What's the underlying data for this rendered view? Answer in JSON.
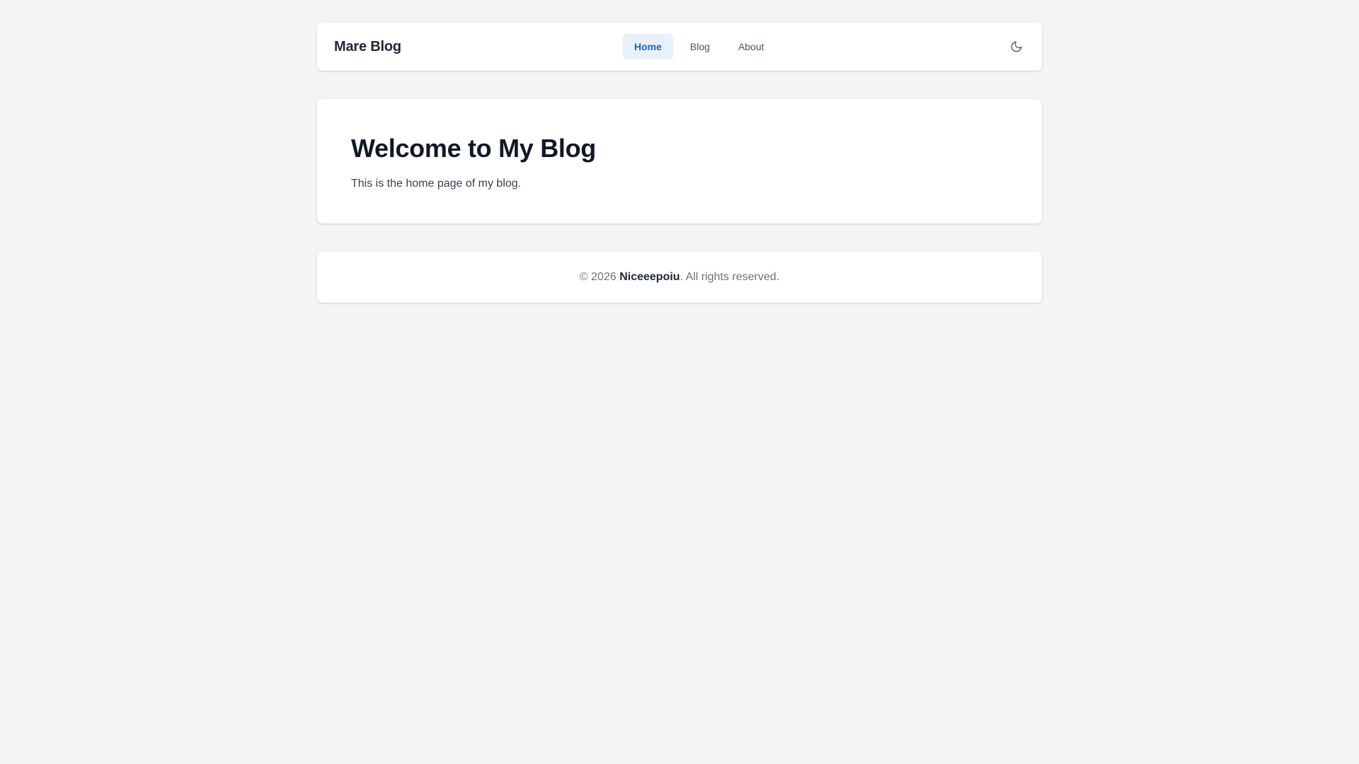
{
  "header": {
    "brand": "Mare Blog",
    "nav": [
      {
        "label": "Home",
        "active": true
      },
      {
        "label": "Blog",
        "active": false
      },
      {
        "label": "About",
        "active": false
      }
    ],
    "theme_toggle_icon": "moon-icon"
  },
  "main": {
    "title": "Welcome to My Blog",
    "description": "This is the home page of my blog."
  },
  "footer": {
    "prefix": "© 2026",
    "author": "Niceeepoiu",
    "suffix": ". All rights reserved."
  },
  "colors": {
    "background": "#f3f4f6",
    "accent": "#1d63c9",
    "accent_bg": "#e8f0fc"
  }
}
